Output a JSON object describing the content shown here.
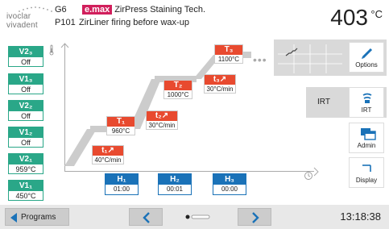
{
  "header": {
    "logo_line1": "ivoclar",
    "logo_line2": "vivadent",
    "program_number": "G6",
    "material_badge": "e.max",
    "product_title": "ZirPress Staining Tech.",
    "program_id": "P101",
    "program_name": "ZirLiner firing before wax-up",
    "temperature": "403",
    "temperature_unit": "°C"
  },
  "vacuum": [
    {
      "label": "V2₃",
      "value": "Off"
    },
    {
      "label": "V1₃",
      "value": "Off"
    },
    {
      "label": "V2₂",
      "value": "Off"
    },
    {
      "label": "V1₂",
      "value": "Off"
    },
    {
      "label": "V2₁",
      "value": "959°C"
    },
    {
      "label": "V1₁",
      "value": "450°C"
    }
  ],
  "curve": {
    "t1_rate": {
      "label": "t₁↗",
      "value": "40°C/min"
    },
    "T1": {
      "label": "T₁",
      "value": "960°C"
    },
    "t2_rate": {
      "label": "t₂↗",
      "value": "30°C/min"
    },
    "T2": {
      "label": "T₂",
      "value": "1000°C"
    },
    "t3_rate": {
      "label": "t₃↗",
      "value": "30°C/min"
    },
    "T3": {
      "label": "T₃",
      "value": "1100°C"
    },
    "H1": {
      "label": "H₁",
      "value": "01:00"
    },
    "H2": {
      "label": "H₂",
      "value": "00:01"
    },
    "H3": {
      "label": "H₃",
      "value": "00:00"
    }
  },
  "side": {
    "options_label": "Options",
    "irt_panel_label": "IRT",
    "irt_button_label": "IRT",
    "admin_label": "Admin",
    "display_label": "Display"
  },
  "footer": {
    "programs_label": "Programs",
    "clock": "13:18:38"
  },
  "colors": {
    "vacuum_green": "#2aa788",
    "temp_red": "#e84a2f",
    "hold_blue": "#1a72b8",
    "emax_pink": "#d11f5c"
  }
}
